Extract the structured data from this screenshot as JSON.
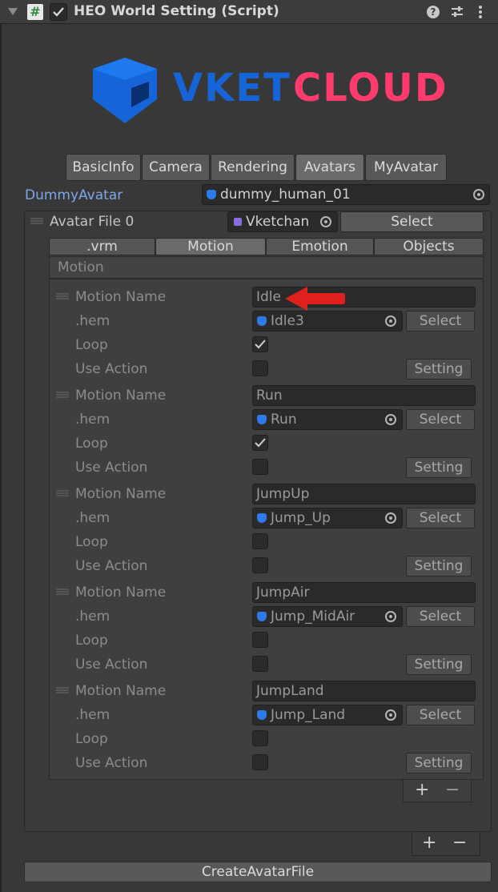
{
  "header": {
    "title": "HEO World Setting (Script)",
    "script_symbol": "#",
    "checkbox_checked": true
  },
  "logo": {
    "word1": "VKET",
    "word2": "CLOUD",
    "colors": {
      "mark": "#1565d8",
      "word1": "#1565d8",
      "word2": "#ff3b6e"
    }
  },
  "tabs": [
    {
      "label": "BasicInfo",
      "active": false
    },
    {
      "label": "Camera",
      "active": false
    },
    {
      "label": "Rendering",
      "active": false
    },
    {
      "label": "Avatars",
      "active": true
    },
    {
      "label": "MyAvatar",
      "active": false
    }
  ],
  "dummy_avatar": {
    "label": "DummyAvatar",
    "value": "dummy_human_01"
  },
  "avatar_file": {
    "label": "Avatar File 0",
    "object_value": "Vketchan",
    "select_label": "Select"
  },
  "sub_tabs": [
    {
      "label": ".vrm",
      "active": false
    },
    {
      "label": "Motion",
      "active": true
    },
    {
      "label": "Emotion",
      "active": false
    },
    {
      "label": "Objects",
      "active": false
    }
  ],
  "motion_section_label": "Motion",
  "motion_labels": {
    "name": "Motion Name",
    "hem": ".hem",
    "loop": "Loop",
    "use_action": "Use Action",
    "select": "Select",
    "setting": "Setting"
  },
  "motions": [
    {
      "name": "Idle",
      "hem": "Idle3",
      "loop": true,
      "use_action": false
    },
    {
      "name": "Run",
      "hem": "Run",
      "loop": true,
      "use_action": false
    },
    {
      "name": "JumpUp",
      "hem": "Jump_Up",
      "loop": false,
      "use_action": false
    },
    {
      "name": "JumpAir",
      "hem": "Jump_MidAir",
      "loop": false,
      "use_action": false
    },
    {
      "name": "JumpLand",
      "hem": "Jump_Land",
      "loop": false,
      "use_action": false
    }
  ],
  "list_controls": {
    "plus": "+",
    "minus": "−"
  },
  "create_button": "CreateAvatarFile",
  "annotation_color": "#e0201c"
}
